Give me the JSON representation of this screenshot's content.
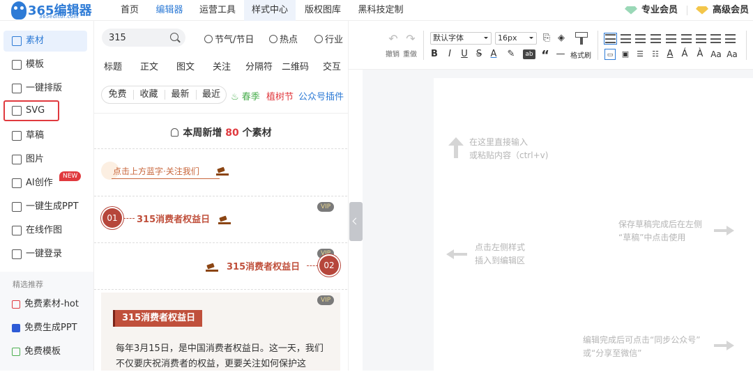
{
  "topbar": {
    "logo_title": "365编辑器",
    "logo_sub": "365editor.com",
    "nav": [
      "首页",
      "编辑器",
      "运营工具",
      "样式中心",
      "版权图库",
      "黑科技定制"
    ],
    "members": [
      "专业会员",
      "高级会员"
    ],
    "member_colors": [
      "#9ad8b7",
      "#f3c64a"
    ]
  },
  "sidebar": {
    "items": [
      "素材",
      "模板",
      "一键排版",
      "SVG",
      "草稿",
      "图片",
      "AI创作",
      "一键生成PPT",
      "在线作图",
      "一键登录"
    ],
    "new_badge": "NEW",
    "rec_title": "精选推荐",
    "rec_items": [
      "免费素材-hot",
      "免费生成PPT",
      "免费模板"
    ]
  },
  "panel": {
    "search_value": "315",
    "topics": [
      "节气/节日",
      "热点",
      "行业"
    ],
    "categories": [
      "标题",
      "正文",
      "图文",
      "关注",
      "分隔符",
      "二维码",
      "交互"
    ],
    "filters": [
      "免费",
      "收藏",
      "最新",
      "最近"
    ],
    "extras": [
      {
        "label": "春季",
        "color": "#4caf50",
        "prefix": "♨"
      },
      {
        "label": "植树节",
        "color": "#e0393e",
        "prefix": ""
      },
      {
        "label": "公众号插件",
        "color": "#2e7bd6",
        "prefix": ""
      }
    ],
    "weekly_prefix": "本周新增",
    "weekly_count": "80",
    "weekly_suffix": "个素材",
    "follow_text": "点击上方蓝字·关注我们",
    "vip": "VIP",
    "item1_num": "01",
    "item1_title": "315消费者权益日",
    "item2_num": "02",
    "item2_title": "315消费者权益日",
    "card_banner": "315消费者权益日",
    "card_text": "每年3月15日，是中国消费者权益日。这一天，我们不仅要庆祝消费者的权益，更要关注如何保护这"
  },
  "toolbar": {
    "undo": "撤销",
    "redo": "重做",
    "font": "默认字体",
    "size": "16px",
    "format_brush": "格式刷",
    "font_letters": [
      "B",
      "I",
      "U",
      "S",
      "A",
      "ab",
      "“",
      "—"
    ]
  },
  "editor": {
    "hint_input": [
      "在这里直接输入",
      "或粘贴内容（ctrl+v)"
    ],
    "hint_insert": [
      "点击左侧样式",
      "插入到编辑区"
    ],
    "hint_draft": [
      "保存草稿完成后在左侧",
      "“草稿”中点击使用"
    ],
    "hint_sync": [
      "编辑完成后可点击“同步公众号”",
      "或“分享至微信”"
    ]
  }
}
